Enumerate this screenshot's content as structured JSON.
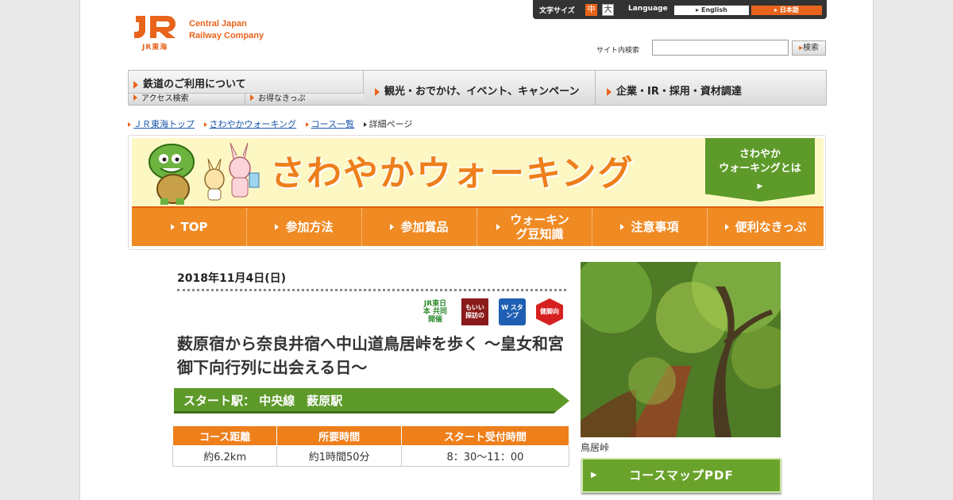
{
  "logo": {
    "kanji": "JR東海",
    "line1": "Central Japan",
    "line2": "Railway Company"
  },
  "util": {
    "font_size_label": "文字サイズ",
    "font_mid": "中",
    "font_big": "大",
    "language_label": "Language",
    "lang_english": "English",
    "lang_japanese": "日本語"
  },
  "search": {
    "label": "サイト内検索",
    "button": "検索",
    "value": ""
  },
  "gnav": {
    "rail_use": "鉄道のご利用について",
    "access": "アクセス検索",
    "tickets": "お得なきっぷ",
    "tourism": "観光・おでかけ、イベント、キャンペーン",
    "corporate": "企業・IR・採用・資材調達"
  },
  "breadcrumb": {
    "items": [
      "ＪＲ東海トップ",
      "さわやかウォーキング",
      "コース一覧"
    ],
    "current": "詳細ページ"
  },
  "banner": {
    "title": "さわやかウォーキング",
    "about": [
      "さわやか",
      "ウォーキングとは"
    ],
    "nav": [
      "TOP",
      "参加方法",
      "参加賞品",
      "ウォーキング豆知識",
      "注意事項",
      "便利なきっぷ"
    ]
  },
  "event": {
    "date": "2018年11月4日(日)",
    "badges": [
      "JR東日本 共同開催",
      "もいい 探訪の",
      "W スタンプ",
      "健脚向"
    ],
    "title": "薮原宿から奈良井宿へ中山道鳥居峠を歩く ～皇女和宮御下向行列に出会える日～",
    "start_station": "スタート駅： 中央線　薮原駅",
    "table_headers": [
      "コース距離",
      "所要時間",
      "スタート受付時間"
    ],
    "table_values": [
      "約6.2km",
      "約1時間50分",
      "8：30～11：00"
    ],
    "photo_caption": "鳥居峠",
    "pdf_button": "コースマップPDF"
  },
  "colors": {
    "orange": "#ee7f1b",
    "green": "#5d9a2a",
    "link": "#1a56a8"
  }
}
